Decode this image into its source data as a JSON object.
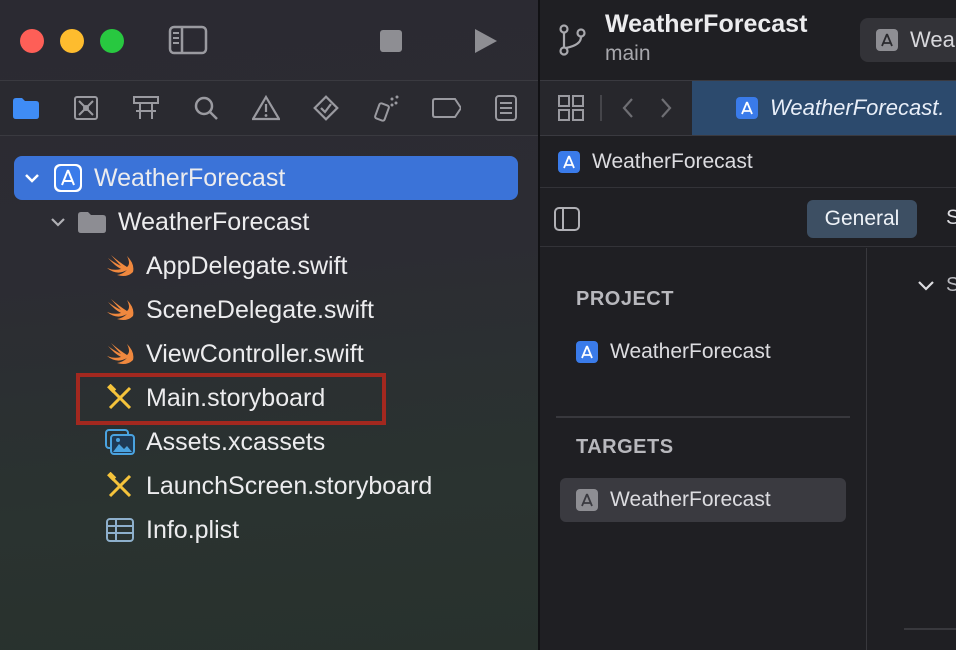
{
  "window": {
    "title": "WeatherForecast",
    "branch": "main",
    "scheme_label": "Wea"
  },
  "navigator": {
    "tabs": [
      "folder-icon",
      "source-control-icon",
      "hierarchy-icon",
      "search-icon",
      "warning-icon",
      "test-icon",
      "debug-icon",
      "breakpoint-icon",
      "report-icon"
    ],
    "tree": [
      {
        "label": "WeatherForecast",
        "kind": "project",
        "level": 0,
        "selected": true
      },
      {
        "label": "WeatherForecast",
        "kind": "folder",
        "level": 1
      },
      {
        "label": "AppDelegate.swift",
        "kind": "swift",
        "level": 2
      },
      {
        "label": "SceneDelegate.swift",
        "kind": "swift",
        "level": 2
      },
      {
        "label": "ViewController.swift",
        "kind": "swift",
        "level": 2
      },
      {
        "label": "Main.storyboard",
        "kind": "storyboard",
        "level": 2,
        "highlighted": true
      },
      {
        "label": "Assets.xcassets",
        "kind": "assets",
        "level": 2
      },
      {
        "label": "LaunchScreen.storyboard",
        "kind": "storyboard",
        "level": 2
      },
      {
        "label": "Info.plist",
        "kind": "plist",
        "level": 2
      }
    ]
  },
  "editor": {
    "active_tab": "WeatherForecast.",
    "breadcrumb": "WeatherForecast",
    "general_tab": "General",
    "next_tab_peek": "S",
    "project_header": "PROJECT",
    "project_item": "WeatherForecast",
    "targets_header": "TARGETS",
    "target_item": "WeatherForecast",
    "section_chevron_peek": "S"
  },
  "colors": {
    "selection": "#3b73d8",
    "highlight_box": "#a3281f",
    "swift": "#f0883e",
    "storyboard": "#f5c33b",
    "assets": "#4aa3e0"
  }
}
